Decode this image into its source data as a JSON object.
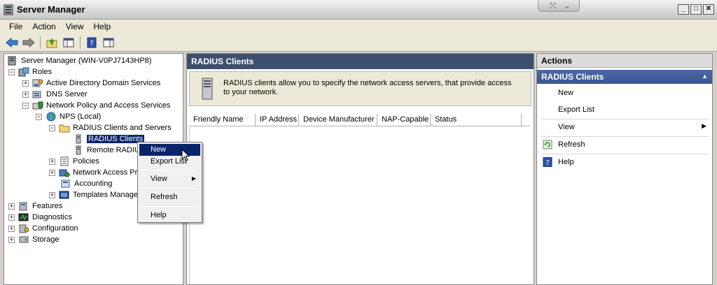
{
  "window": {
    "title": "Server Manager"
  },
  "menubar": {
    "items": [
      "File",
      "Action",
      "View",
      "Help"
    ]
  },
  "tree": {
    "root": "Server Manager (WIN-V0PJ7143HP8)",
    "roles": "Roles",
    "ad": "Active Directory Domain Services",
    "dns": "DNS Server",
    "npas": "Network Policy and Access Services",
    "nps": "NPS (Local)",
    "radius_cs": "RADIUS Clients and Servers",
    "radius_clients": "RADIUS Clients",
    "remote_radius": "Remote RADIU",
    "policies": "Policies",
    "nap": "Network Access Pr",
    "accounting": "Accounting",
    "templates": "Templates Manage",
    "features": "Features",
    "diagnostics": "Diagnostics",
    "configuration": "Configuration",
    "storage": "Storage"
  },
  "center": {
    "header": "RADIUS Clients",
    "info": "RADIUS clients allow you to specify the network access servers, that provide access to your network.",
    "columns": [
      "Friendly Name",
      "IP Address",
      "Device Manufacturer",
      "NAP-Capable",
      "Status"
    ]
  },
  "actions": {
    "header": "Actions",
    "section": "RADIUS Clients",
    "items": {
      "new": "New",
      "export": "Export List",
      "view": "View",
      "refresh": "Refresh",
      "help": "Help"
    }
  },
  "context_menu": {
    "new": "New",
    "export": "Export List",
    "view": "View",
    "refresh": "Refresh",
    "help": "Help"
  },
  "colors": {
    "selection": "#0a246a",
    "pane_header": "#3c4f6e",
    "actions_section": "#4c6aa8"
  }
}
